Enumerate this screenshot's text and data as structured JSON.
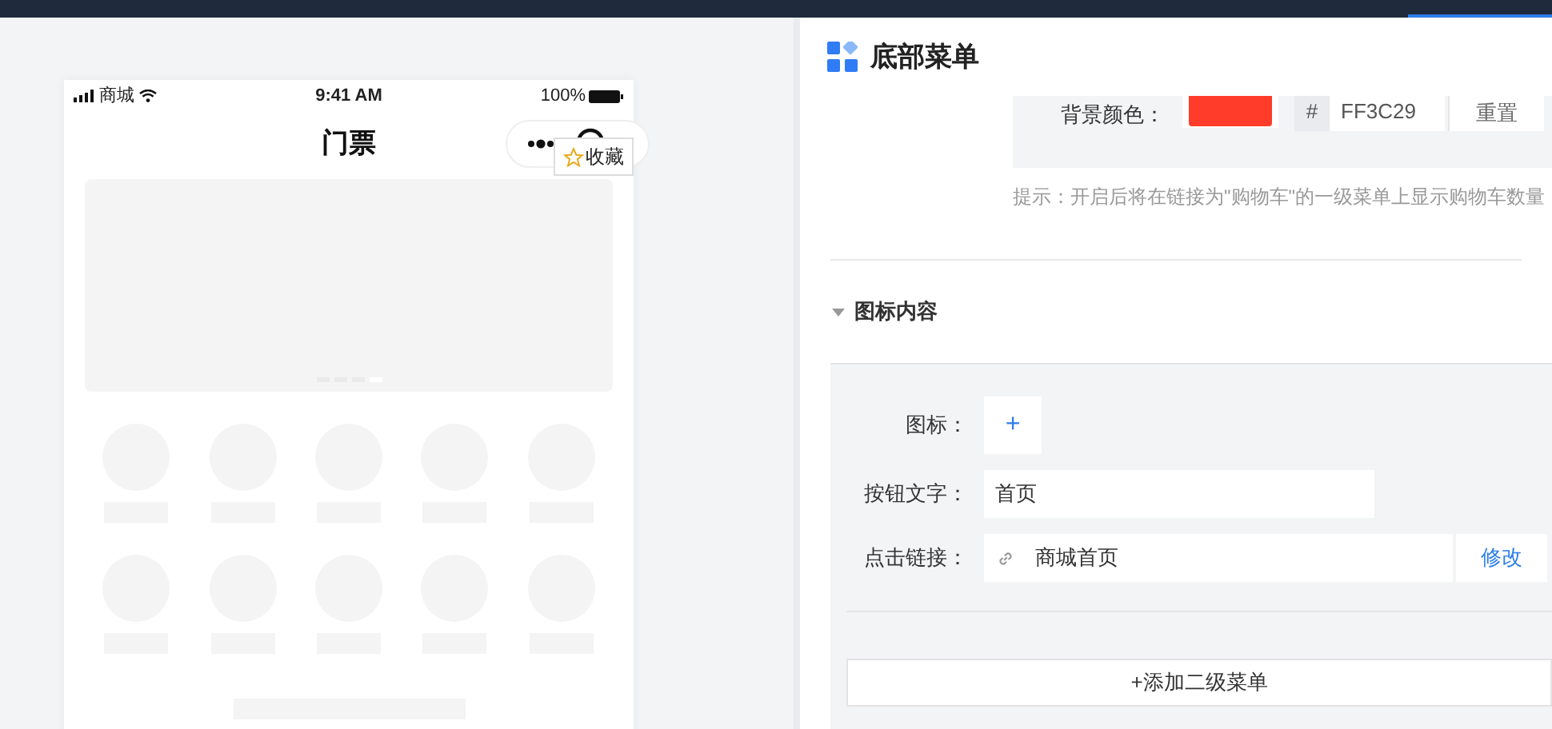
{
  "phone": {
    "status_bar": {
      "carrier": "商城",
      "time": "9:41 AM",
      "battery": "100%"
    },
    "nav_title": "门票",
    "favorite_tip": "收藏"
  },
  "panel": {
    "title": "底部菜单",
    "bg_color": {
      "label": "背景颜色：",
      "color": "#ff3c29",
      "prefix": "#",
      "value": "FF3C29",
      "reset": "重置"
    },
    "hint": "提示：开启后将在链接为\"购物车\"的一级菜单上显示购物车数量",
    "section": {
      "title": "图标内容",
      "expanded": true
    },
    "icon_label": "图标：",
    "icon_add": "+",
    "text_label": "按钮文字：",
    "text_value": "首页",
    "link_label": "点击链接：",
    "link_value": "商城首页",
    "link_edit": "修改",
    "add_submenu": "+添加二级菜单"
  }
}
